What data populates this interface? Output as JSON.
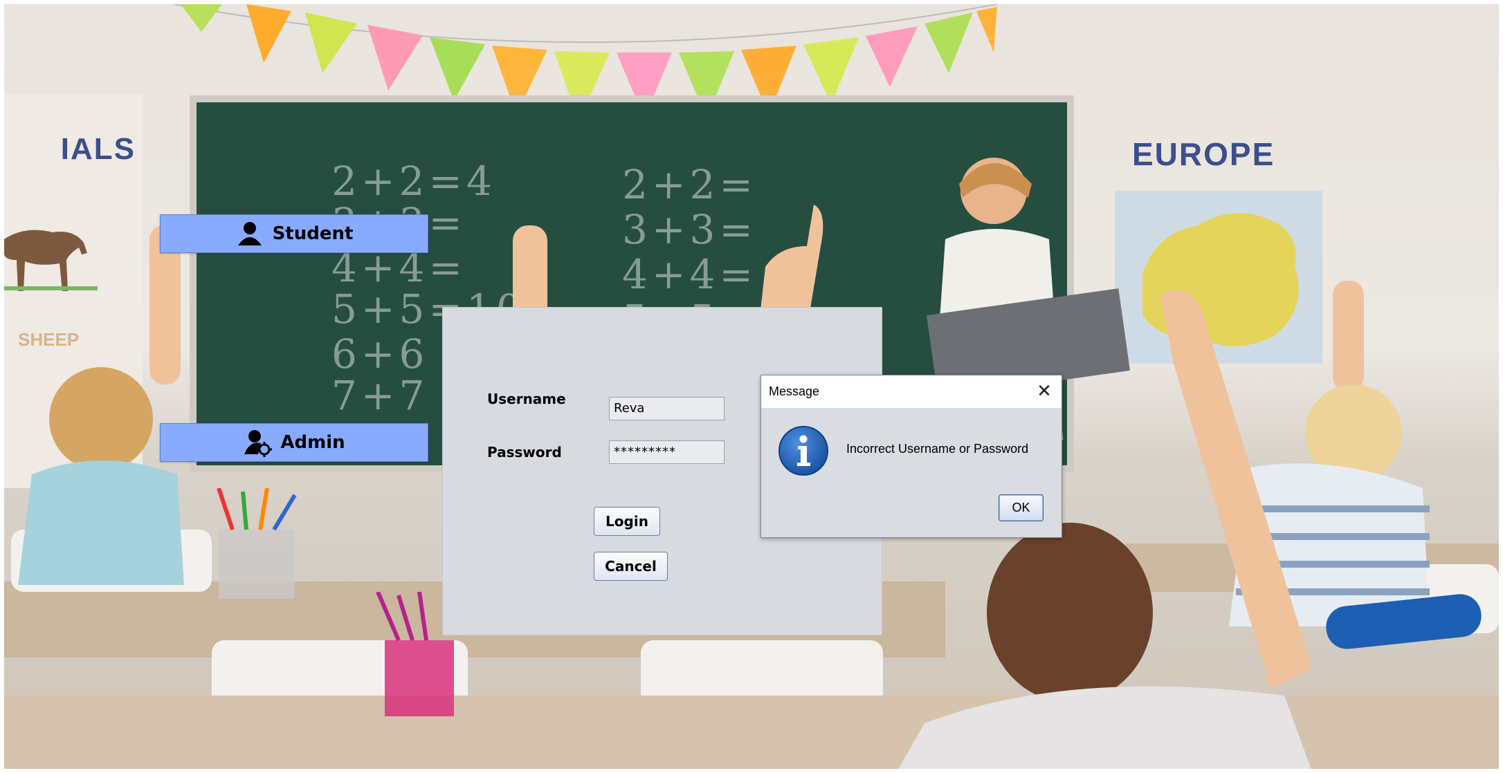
{
  "side_buttons": {
    "student": {
      "label": "Student",
      "icon": "user-icon"
    },
    "admin": {
      "label": "Admin",
      "icon": "user-gear-icon"
    }
  },
  "background": {
    "wall_left_text": "IALS",
    "wall_right_text": "EUROPE",
    "sheep_text": "SHEEP",
    "chalkboard_left": [
      "2+2=4",
      "3+3=",
      "4+4=",
      "5+5=10",
      "6+6",
      "7+7"
    ],
    "chalkboard_right": [
      "2+2=",
      "3+3=",
      "4+4=",
      "5+5="
    ]
  },
  "login_form": {
    "username_label": "Username",
    "password_label": "Password",
    "username_value": "Reva",
    "password_value": "*********",
    "login_label": "Login",
    "cancel_label": "Cancel"
  },
  "dialog": {
    "title": "Message",
    "close_glyph": "✕",
    "icon": "info-icon",
    "message": "Incorrect Username or Password",
    "ok_label": "OK"
  },
  "colors": {
    "side_button_bg": "#88abff",
    "panel_bg": "#d7dadf",
    "info_icon": "#1d5fb6",
    "chalkboard": "#254e40"
  }
}
